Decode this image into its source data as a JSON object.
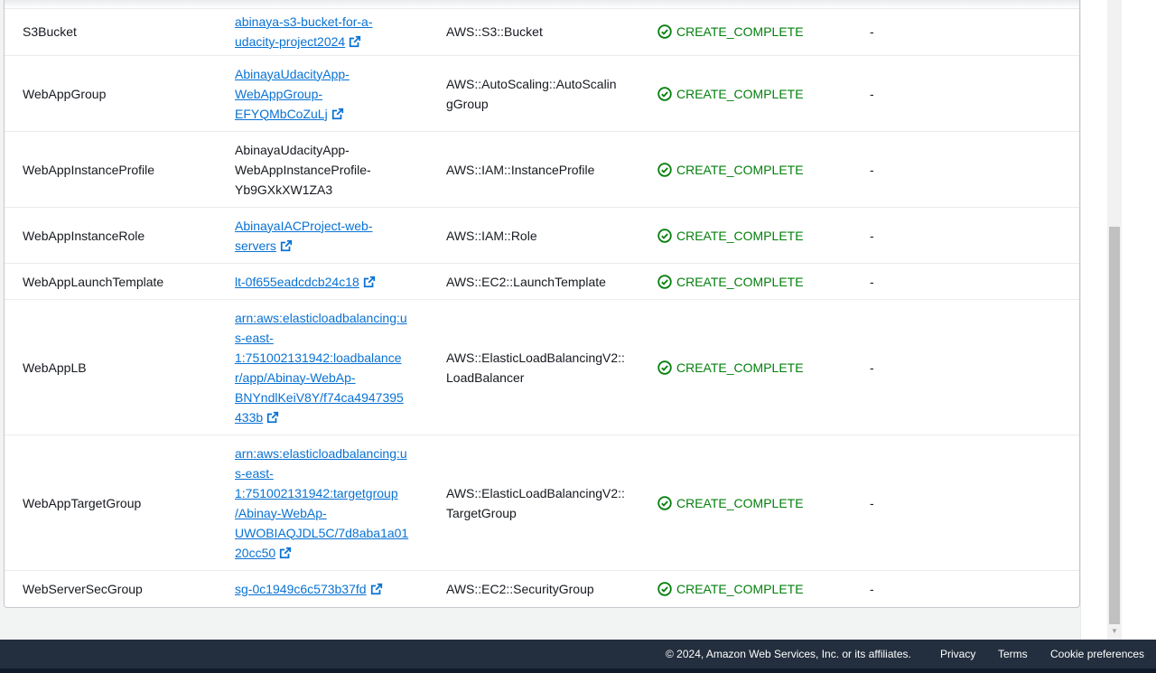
{
  "resources": [
    {
      "logical_id": "S3Bucket",
      "physical_id": "abinaya-s3-bucket-for-a-udacity-project2024",
      "physical_link": true,
      "type": "AWS::S3::Bucket",
      "status": "CREATE_COMPLETE",
      "status_reason": "-"
    },
    {
      "logical_id": "WebAppGroup",
      "physical_id": "AbinayaUdacityApp-WebAppGroup-EFYQMbCoZuLj",
      "physical_link": true,
      "type": "AWS::AutoScaling::AutoScalingGroup",
      "status": "CREATE_COMPLETE",
      "status_reason": "-"
    },
    {
      "logical_id": "WebAppInstanceProfile",
      "physical_id": "AbinayaUdacityApp-WebAppInstanceProfile-Yb9GXkXW1ZA3",
      "physical_link": false,
      "type": "AWS::IAM::InstanceProfile",
      "status": "CREATE_COMPLETE",
      "status_reason": "-"
    },
    {
      "logical_id": "WebAppInstanceRole",
      "physical_id": "AbinayaIACProject-web-servers",
      "physical_link": true,
      "type": "AWS::IAM::Role",
      "status": "CREATE_COMPLETE",
      "status_reason": "-"
    },
    {
      "logical_id": "WebAppLaunchTemplate",
      "physical_id": "lt-0f655eadcdcb24c18",
      "physical_link": true,
      "type": "AWS::EC2::LaunchTemplate",
      "status": "CREATE_COMPLETE",
      "status_reason": "-"
    },
    {
      "logical_id": "WebAppLB",
      "physical_id": "arn:aws:elasticloadbalancing:us-east-1:751002131942:loadbalancer/app/Abinay-WebAp-BNYndlKeiV8Y/f74ca4947395433b",
      "physical_link": true,
      "type": "AWS::ElasticLoadBalancingV2::LoadBalancer",
      "status": "CREATE_COMPLETE",
      "status_reason": "-"
    },
    {
      "logical_id": "WebAppTargetGroup",
      "physical_id": "arn:aws:elasticloadbalancing:us-east-1:751002131942:targetgroup/Abinay-WebAp-UWOBIAQJDL5C/7d8aba1a0120cc50",
      "physical_link": true,
      "type": "AWS::ElasticLoadBalancingV2::TargetGroup",
      "status": "CREATE_COMPLETE",
      "status_reason": "-"
    },
    {
      "logical_id": "WebServerSecGroup",
      "physical_id": "sg-0c1949c6c573b37fd",
      "physical_link": true,
      "type": "AWS::EC2::SecurityGroup",
      "status": "CREATE_COMPLETE",
      "status_reason": "-"
    }
  ],
  "footer": {
    "copyright": "© 2024, Amazon Web Services, Inc. or its affiliates.",
    "privacy": "Privacy",
    "terms": "Terms",
    "cookies": "Cookie preferences"
  },
  "colors": {
    "link": "#0972d3",
    "success": "#037f0c",
    "footer_bg": "#232f3e"
  },
  "icons": {
    "external_link": "external-link-icon",
    "status": "status-success-icon"
  }
}
